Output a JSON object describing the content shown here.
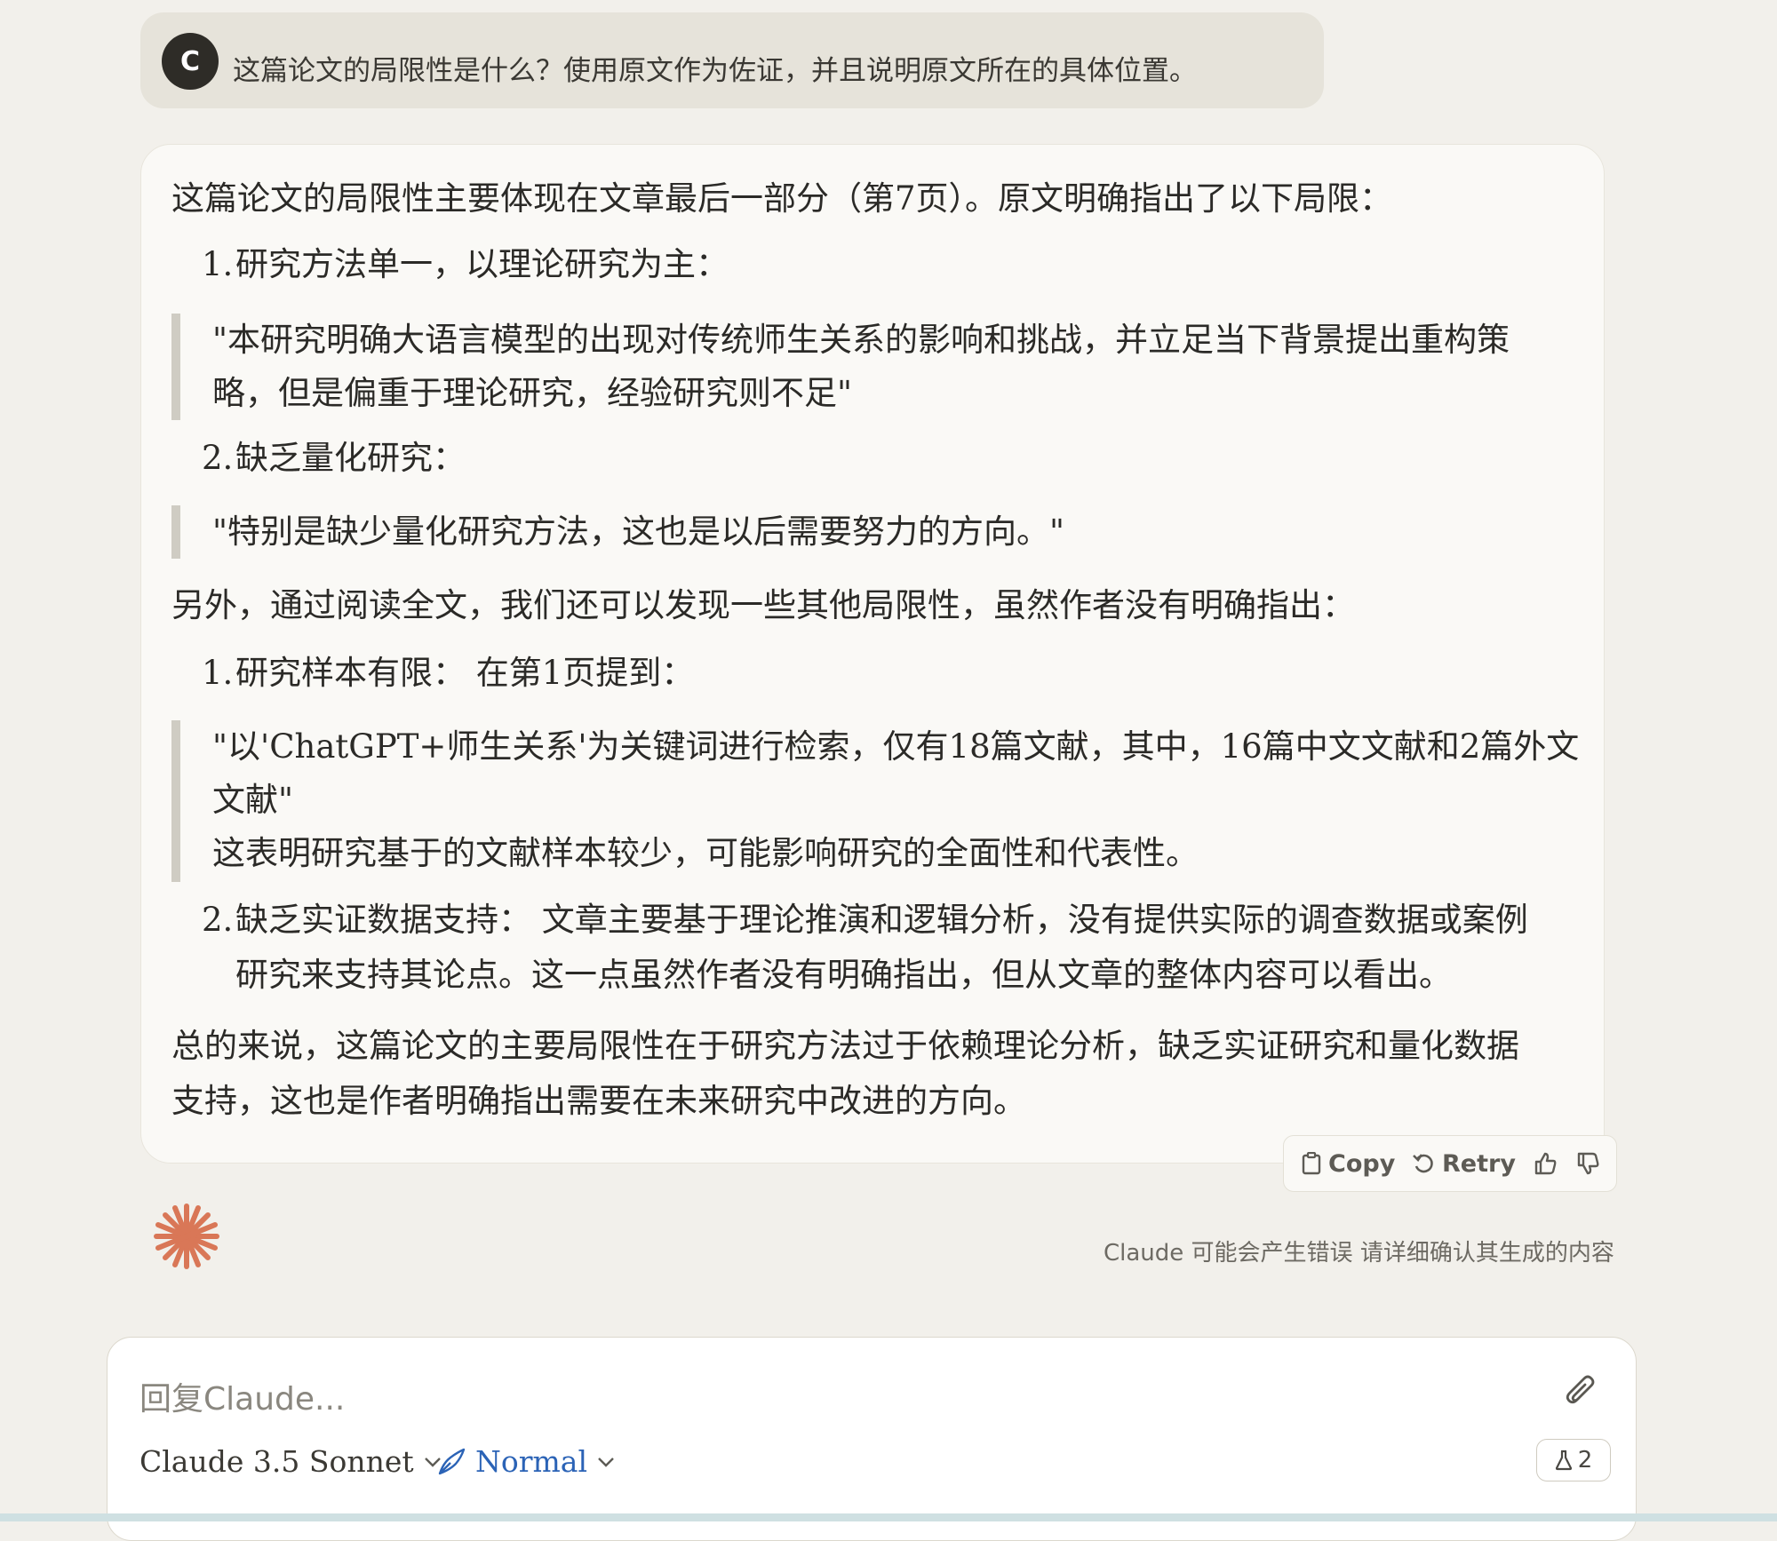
{
  "user_message": {
    "avatar_initial": "C",
    "text": "这篇论文的局限性是什么？使用原文作为佐证，并且说明原文所在的具体位置。"
  },
  "assistant_message": {
    "intro": "这篇论文的局限性主要体现在文章最后一部分（第7页）。原文明确指出了以下局限：",
    "explicit_limits": [
      {
        "num": "1.",
        "title": "研究方法单一，以理论研究为主：",
        "quote_lines": [
          "\"本研究明确大语言模型的出现对传统师生关系的影响和挑战，并立足当下背景提出重构策",
          "略，但是偏重于理论研究，经验研究则不足\""
        ]
      },
      {
        "num": "2.",
        "title": "缺乏量化研究：",
        "quote_lines": [
          "\"特别是缺少量化研究方法，这也是以后需要努力的方向。\""
        ]
      }
    ],
    "other_intro": "另外，通过阅读全文，我们还可以发现一些其他局限性，虽然作者没有明确指出：",
    "implicit_limits": [
      {
        "num": "1.",
        "title": "研究样本有限： 在第1页提到：",
        "quote_lines": [
          "\"以'ChatGPT+师生关系'为关键词进行检索，仅有18篇文献，其中，16篇中文文献和2篇外文",
          "文献\"",
          "这表明研究基于的文献样本较少，可能影响研究的全面性和代表性。"
        ]
      },
      {
        "num": "2.",
        "lines": [
          "缺乏实证数据支持： 文章主要基于理论推演和逻辑分析，没有提供实际的调查数据或案例",
          "研究来支持其论点。这一点虽然作者没有明确指出，但从文章的整体内容可以看出。"
        ]
      }
    ],
    "conclusion_lines": [
      "总的来说，这篇论文的主要局限性在于研究方法过于依赖理论分析，缺乏实证研究和量化数据",
      "支持，这也是作者明确指出需要在未来研究中改进的方向。"
    ]
  },
  "actions": {
    "copy_label": "Copy",
    "retry_label": "Retry"
  },
  "disclaimer": "Claude 可能会产生错误 请详细确认其生成的内容",
  "composer": {
    "placeholder": "回复Claude...",
    "model": "Claude 3.5 Sonnet",
    "style": "Normal",
    "badge_count": "2"
  },
  "colors": {
    "accent_orange": "#d97757",
    "style_blue": "#2b63b6"
  }
}
